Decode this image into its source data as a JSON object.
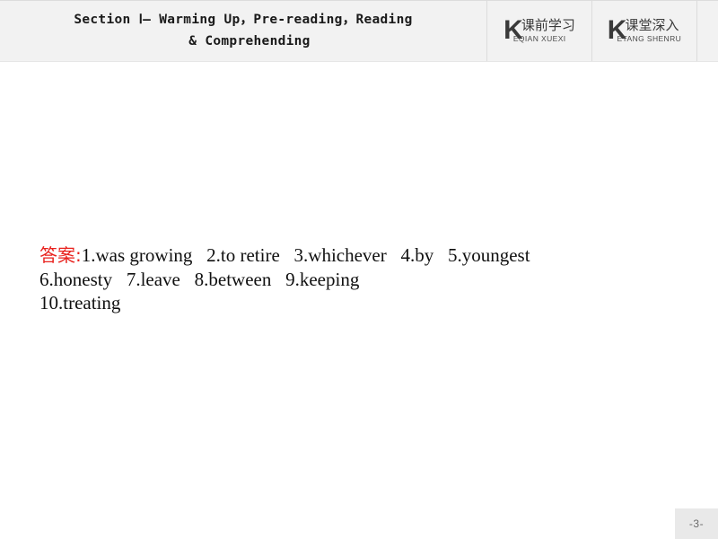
{
  "header": {
    "title_line1": "Section Ⅰ— Warming Up，Pre-reading，Reading",
    "title_line2": "& Comprehending",
    "tabs": [
      {
        "initial": "K",
        "cn": "课前学习",
        "en": "EQIAN XUEXI"
      },
      {
        "initial": "K",
        "cn": "课堂深入",
        "en": "ETANG SHENRU"
      }
    ]
  },
  "main": {
    "answer_label": "答案:",
    "answer_lines": [
      "1.was growing   2.to retire   3.whichever   4.by   5.youngest",
      "6.honesty   7.leave   8.between   9.keeping",
      "10.treating"
    ]
  },
  "footer": {
    "page_number": "-3-"
  },
  "colors": {
    "accent_red": "#e8201c",
    "header_bg": "#f2f2f2",
    "divider": "#dcdcdc",
    "page_badge_bg": "#e9e9e9",
    "text": "#101010"
  }
}
